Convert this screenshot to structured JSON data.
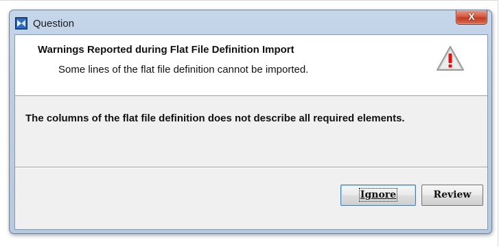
{
  "window": {
    "title": "Question",
    "close_glyph": "X",
    "app_icon": "jdeveloper-app-icon",
    "close_icon": "close-icon"
  },
  "header": {
    "title": "Warnings Reported during Flat File Definition Import",
    "subtitle": "Some lines of the flat file definition cannot be imported.",
    "icon": "warning-triangle-icon",
    "icon_colors": {
      "triangle": "#c8c8c8",
      "exclamation": "#e01010"
    }
  },
  "body": {
    "message": "The columns of the flat file definition does not describe all required elements."
  },
  "buttons": {
    "ignore_label": "Ignore",
    "review_label": "Review",
    "default": "Ignore"
  },
  "colors": {
    "title_bar": "#c6d6ea",
    "close_button": "#c23b22",
    "content_bg": "#f0f0f0",
    "header_bg": "#ffffff",
    "focus_border": "#3c7fb1"
  }
}
